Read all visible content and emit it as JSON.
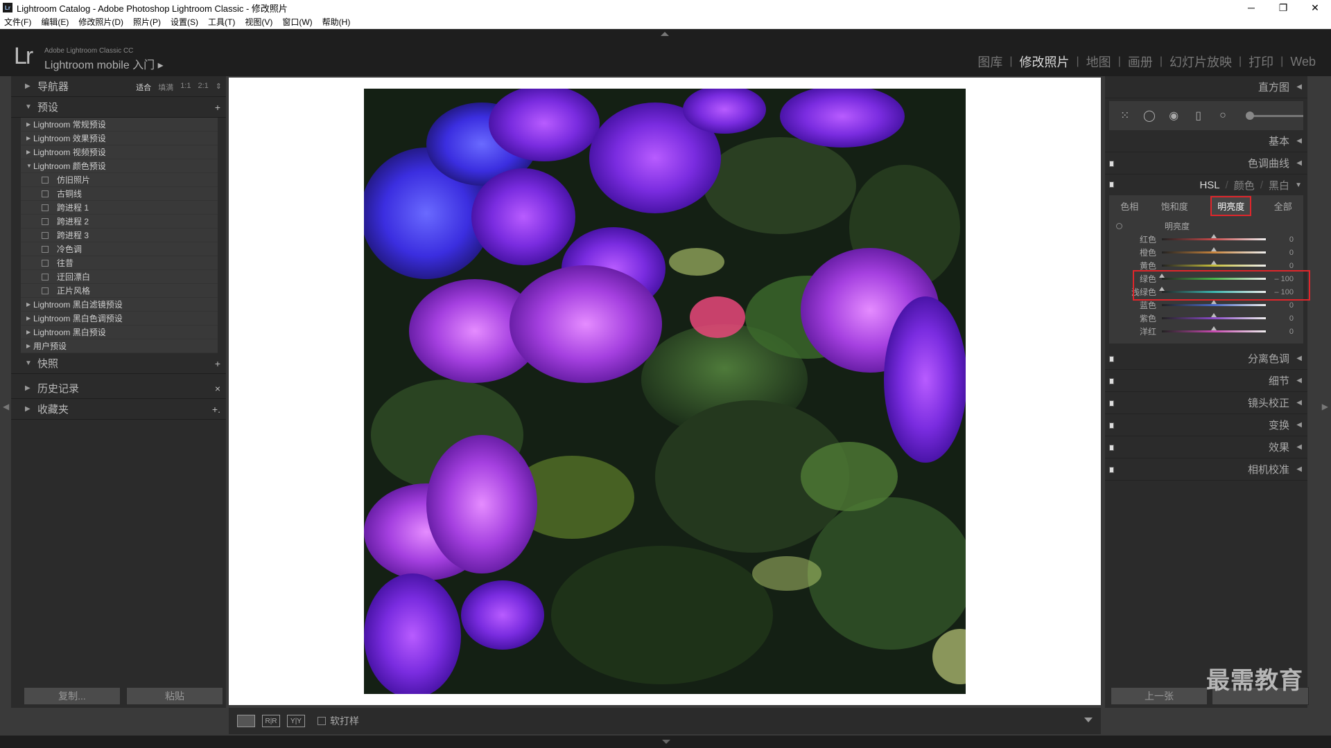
{
  "window": {
    "title": "Lightroom Catalog - Adobe Photoshop Lightroom Classic - 修改照片",
    "app_icon": "Lr"
  },
  "menu": [
    "文件(F)",
    "编辑(E)",
    "修改照片(D)",
    "照片(P)",
    "设置(S)",
    "工具(T)",
    "视图(V)",
    "窗口(W)",
    "帮助(H)"
  ],
  "identity": {
    "logo": "Lr",
    "product": "Adobe Lightroom Classic CC",
    "plate": "Lightroom mobile 入门",
    "plate_arrow": "▸"
  },
  "modules": [
    "图库",
    "修改照片",
    "地图",
    "画册",
    "幻灯片放映",
    "打印",
    "Web"
  ],
  "active_module": "修改照片",
  "left": {
    "navigator": {
      "label": "导航器",
      "zoom": [
        "适合",
        "填满",
        "1:1",
        "2:1"
      ],
      "zoom_active": "适合"
    },
    "presets": {
      "label": "预设",
      "add": "+",
      "folders_top": [
        "Lightroom 常规预设",
        "Lightroom 效果预设",
        "Lightroom 视频预设",
        "Lightroom 颜色预设"
      ],
      "items": [
        "仿旧照片",
        "古铜线",
        "跨进程 1",
        "跨进程 2",
        "跨进程 3",
        "冷色调",
        "往昔",
        "迂回漂白",
        "正片风格"
      ],
      "folders_bottom": [
        "Lightroom 黑白滤镜预设",
        "Lightroom 黑白色调预设",
        "Lightroom 黑白预设",
        "用户预设"
      ]
    },
    "snapshots": {
      "label": "快照",
      "add": "+"
    },
    "history": {
      "label": "历史记录",
      "clear": "×"
    },
    "collections": {
      "label": "收藏夹",
      "add": "+."
    },
    "copy_label": "复制...",
    "paste_label": "粘贴"
  },
  "toolbar": {
    "view_loupe": "",
    "view_before_after": "R|R",
    "view_yy": "Y|Y",
    "soft_proof_label": "软打样"
  },
  "right": {
    "histogram": "直方图",
    "basic": "基本",
    "tone_curve": "色调曲线",
    "hsl": {
      "tabs_top": [
        "HSL",
        "颜色",
        "黑白"
      ],
      "active_top": "HSL",
      "tabs": [
        "色相",
        "饱和度",
        "明亮度",
        "全部"
      ],
      "active_tab": "明亮度",
      "section_title": "明亮度",
      "sliders": [
        {
          "label": "红色",
          "value": "0",
          "level": 0,
          "color": "#c84a4a"
        },
        {
          "label": "橙色",
          "value": "0",
          "level": 0,
          "color": "#c8843c"
        },
        {
          "label": "黄色",
          "value": "0",
          "level": 0,
          "color": "#c8c03c"
        },
        {
          "label": "绿色",
          "value": "– 100",
          "level": -100,
          "color": "#4ab84a"
        },
        {
          "label": "浅绿色",
          "value": "– 100",
          "level": -100,
          "color": "#3cb8b0"
        },
        {
          "label": "蓝色",
          "value": "0",
          "level": 0,
          "color": "#4a6ac8"
        },
        {
          "label": "紫色",
          "value": "0",
          "level": 0,
          "color": "#8a4ac8"
        },
        {
          "label": "洋红",
          "value": "0",
          "level": 0,
          "color": "#c84ab0"
        }
      ]
    },
    "split_toning": "分离色调",
    "detail": "细节",
    "lens": "镜头校正",
    "transform": "变换",
    "effects": "效果",
    "calibration": "相机校准",
    "prev_label": "上一张",
    "watermark": "最需教育"
  },
  "colors": {
    "highlight": "#e0262b",
    "panel": "#2b2b2b",
    "panel_inner": "#393939"
  }
}
